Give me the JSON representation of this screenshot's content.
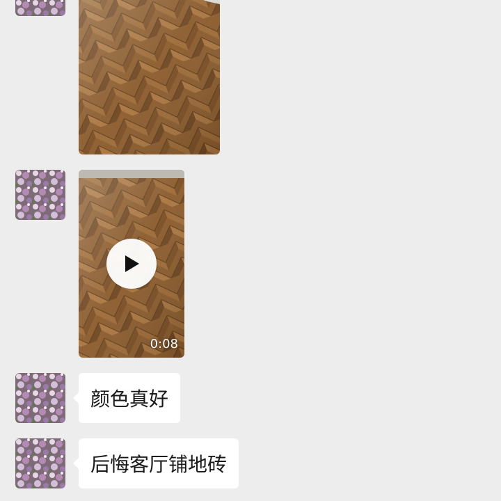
{
  "chat": {
    "messages": [
      {
        "type": "image",
        "content": "wood-floor-photo"
      },
      {
        "type": "video",
        "duration": "0:08",
        "content": "wood-floor-video"
      },
      {
        "type": "text",
        "text": "颜色真好"
      },
      {
        "type": "text",
        "text": "后悔客厅铺地砖"
      }
    ]
  },
  "colors": {
    "background": "#ededed",
    "bubble": "#ffffff",
    "text": "#191919",
    "wood": "#8a5a2b"
  },
  "icons": [
    "lilac-avatar",
    "play-icon"
  ]
}
